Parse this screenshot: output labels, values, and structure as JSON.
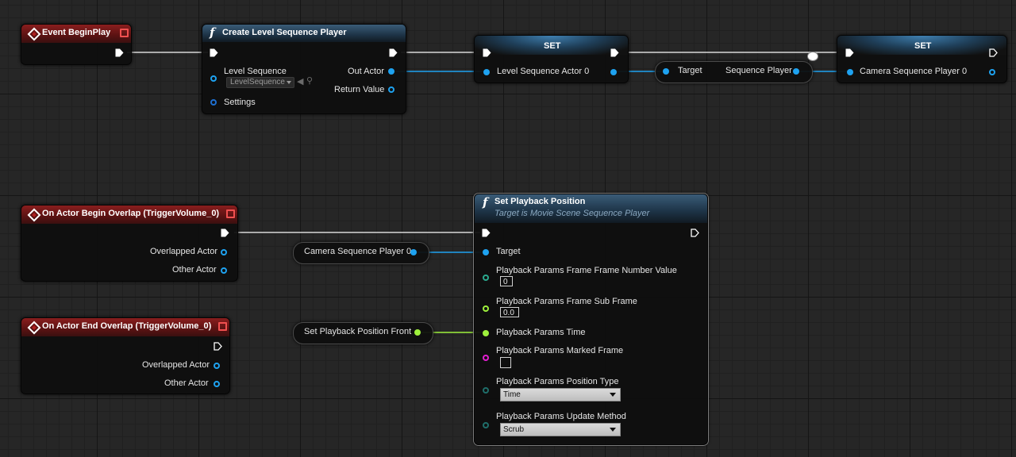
{
  "nodes": {
    "event_begin_play": {
      "title": "Event BeginPlay"
    },
    "create_player": {
      "title": "Create Level Sequence Player",
      "level_sequence_label": "Level Sequence",
      "level_sequence_value": "LevelSequence",
      "settings_label": "Settings",
      "out_actor_label": "Out Actor",
      "return_value_label": "Return Value"
    },
    "set1": {
      "title": "SET",
      "var_label": "Level Sequence Actor 0"
    },
    "get_sequence_player": {
      "target_label": "Target",
      "output_label": "Sequence Player"
    },
    "set2": {
      "title": "SET",
      "var_label": "Camera Sequence Player 0"
    },
    "begin_overlap": {
      "title": "On Actor Begin Overlap (TriggerVolume_0)",
      "overlapped_label": "Overlapped Actor",
      "other_label": "Other Actor"
    },
    "end_overlap": {
      "title": "On Actor End Overlap (TriggerVolume_0)",
      "overlapped_label": "Overlapped Actor",
      "other_label": "Other Actor"
    },
    "camera_var": {
      "label": "Camera Sequence Player 0"
    },
    "front_var": {
      "label": "Set Playback Position Front"
    },
    "set_playback": {
      "title": "Set Playback Position",
      "subtitle": "Target is Movie Scene Sequence Player",
      "target_label": "Target",
      "frame_number_label": "Playback Params Frame Frame Number Value",
      "frame_number_value": "0",
      "sub_frame_label": "Playback Params Frame Sub Frame",
      "sub_frame_value": "0.0",
      "time_label": "Playback Params Time",
      "marked_frame_label": "Playback Params Marked Frame",
      "position_type_label": "Playback Params Position Type",
      "position_type_value": "Time",
      "update_method_label": "Playback Params Update Method",
      "update_method_value": "Scrub"
    }
  },
  "colors": {
    "exec_wire": "#d8d8d8",
    "object_wire": "#1ea2f0",
    "float_wire": "#9ef03c",
    "event_header": "#8a1e1e",
    "function_header": "#2a4a66"
  },
  "icons": {
    "event": "event-diamond-icon",
    "function": "function-f-icon",
    "delegate": "delegate-square-icon",
    "exec": "exec-arrow-icon"
  }
}
